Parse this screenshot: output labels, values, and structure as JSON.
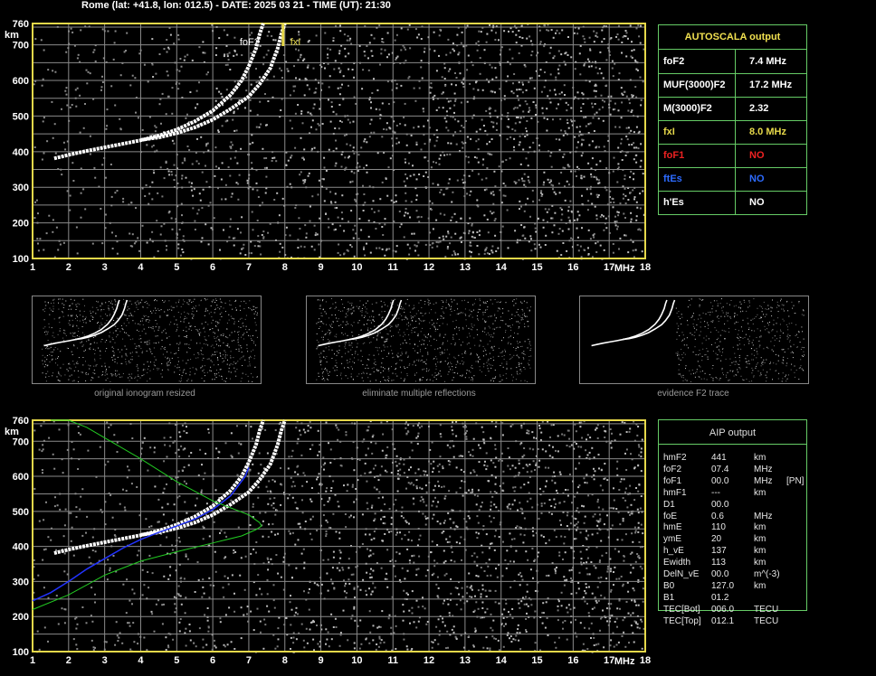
{
  "header": "Rome (lat: +41.8, lon: 012.5) - DATE: 2025 03 21 - TIME (UT): 21:30",
  "axes": {
    "x_ticks": [
      "1",
      "2",
      "3",
      "4",
      "5",
      "6",
      "7",
      "8",
      "9",
      "10",
      "11",
      "12",
      "13",
      "14",
      "15",
      "16",
      "17",
      "18"
    ],
    "y_ticks": [
      "100",
      "200",
      "300",
      "400",
      "500",
      "600",
      "700",
      "760"
    ],
    "x_unit": "MHz",
    "y_unit": "km"
  },
  "trace_labels": {
    "foF2": "foF2",
    "fxI": "fxI"
  },
  "autoscala": {
    "title": "AUTOSCALA output",
    "rows": [
      {
        "label": "foF2",
        "value": "7.4 MHz",
        "color": "#ffffff"
      },
      {
        "label": "MUF(3000)F2",
        "value": "17.2 MHz",
        "color": "#ffffff"
      },
      {
        "label": "M(3000)F2",
        "value": "2.32",
        "color": "#ffffff"
      },
      {
        "label": "fxI",
        "value": "8.0 MHz",
        "color": "#e6d84a"
      },
      {
        "label": "foF1",
        "value": "NO",
        "color": "#ee2222"
      },
      {
        "label": "ftEs",
        "value": "NO",
        "color": "#2d6bff"
      },
      {
        "label": "h'Es",
        "value": "NO",
        "color": "#ffffff"
      }
    ]
  },
  "thumb_captions": [
    "original ionogram resized",
    "eliminate multiple reflections",
    "evidence F2 trace"
  ],
  "aip": {
    "title": "AIP output",
    "rows": [
      [
        "hmF2",
        "441",
        "km",
        ""
      ],
      [
        "foF2",
        "07.4",
        "MHz",
        ""
      ],
      [
        "foF1",
        "00.0",
        "MHz",
        "[PN]"
      ],
      [
        "hmF1",
        "---",
        "km",
        ""
      ],
      [
        "D1",
        "00.0",
        "",
        ""
      ],
      [
        "foE",
        "0.6",
        "MHz",
        ""
      ],
      [
        "hmE",
        "110",
        "km",
        ""
      ],
      [
        "ymE",
        "20",
        "km",
        ""
      ],
      [
        "h_vE",
        "137",
        "km",
        ""
      ],
      [
        "Ewidth",
        "113",
        "km",
        ""
      ],
      [
        "DelN_vE",
        "00.0",
        "m^(-3)",
        ""
      ],
      [
        "B0",
        "127.0",
        "km",
        ""
      ],
      [
        "B1",
        "01.2",
        "",
        ""
      ],
      [
        "TEC[Bot]",
        "006.0",
        "TECU",
        ""
      ],
      [
        "TEC[Top]",
        "012.1",
        "TECU",
        ""
      ]
    ]
  },
  "colors": {
    "grid": "#8a8a8a",
    "frame": "#e6d84a",
    "box": "#66cc66",
    "trace": "#ffffff",
    "profile_blue": "#2233ff",
    "profile_green": "#22cc22"
  },
  "chart_data": [
    {
      "type": "scatter",
      "name": "ionogram",
      "xlim": [
        1,
        18
      ],
      "ylim": [
        100,
        760
      ],
      "xlabel": "MHz",
      "ylabel": "km",
      "series": [
        {
          "name": "o-trace",
          "x": [
            1.6,
            2.0,
            2.5,
            3.0,
            3.5,
            4.0,
            4.5,
            5.0,
            5.5,
            6.0,
            6.5,
            6.8,
            7.0,
            7.2,
            7.3,
            7.4
          ],
          "y": [
            381,
            391,
            402,
            412,
            422,
            432,
            445,
            462,
            485,
            515,
            560,
            600,
            640,
            690,
            730,
            760
          ]
        },
        {
          "name": "x-trace",
          "x": [
            4.0,
            4.5,
            5.0,
            5.5,
            6.0,
            6.5,
            7.0,
            7.3,
            7.6,
            7.8,
            7.9,
            8.0
          ],
          "y": [
            433,
            440,
            452,
            468,
            490,
            520,
            555,
            590,
            635,
            690,
            730,
            760
          ]
        }
      ]
    },
    {
      "type": "line",
      "name": "aip-profile",
      "xlim": [
        1,
        18
      ],
      "ylim": [
        100,
        760
      ],
      "xlabel": "MHz",
      "ylabel": "km",
      "series": [
        {
          "name": "o-trace",
          "x": [
            1.6,
            2.0,
            2.5,
            3.0,
            3.5,
            4.0,
            4.5,
            5.0,
            5.5,
            6.0,
            6.5,
            6.8,
            7.0,
            7.2,
            7.3,
            7.4
          ],
          "y": [
            381,
            391,
            402,
            412,
            422,
            432,
            445,
            462,
            485,
            515,
            560,
            600,
            640,
            690,
            730,
            760
          ]
        },
        {
          "name": "x-trace",
          "x": [
            4.0,
            4.5,
            5.0,
            5.5,
            6.0,
            6.5,
            7.0,
            7.3,
            7.6,
            7.8,
            7.9,
            8.0
          ],
          "y": [
            433,
            440,
            452,
            468,
            490,
            520,
            555,
            590,
            635,
            690,
            730,
            760
          ]
        },
        {
          "name": "blue-profile",
          "x": [
            1.0,
            1.5,
            2.0,
            2.5,
            3.0,
            3.5,
            4.0,
            4.5,
            5.0,
            5.5,
            6.0,
            6.5,
            6.9,
            7.0
          ],
          "y": [
            245,
            268,
            300,
            335,
            365,
            395,
            420,
            440,
            458,
            478,
            505,
            545,
            600,
            625
          ]
        },
        {
          "name": "green-bottom",
          "x": [
            1.0,
            2.0,
            3.0,
            4.0,
            5.0,
            6.0,
            6.8,
            7.2,
            7.35,
            7.3
          ],
          "y": [
            220,
            262,
            318,
            358,
            385,
            410,
            430,
            448,
            458,
            468
          ]
        },
        {
          "name": "green-top",
          "x": [
            7.3,
            7.0,
            6.5,
            6.0,
            5.0,
            4.0,
            3.0,
            2.5,
            2.0,
            1.5
          ],
          "y": [
            468,
            490,
            510,
            530,
            585,
            650,
            710,
            740,
            760,
            760
          ]
        }
      ]
    }
  ]
}
